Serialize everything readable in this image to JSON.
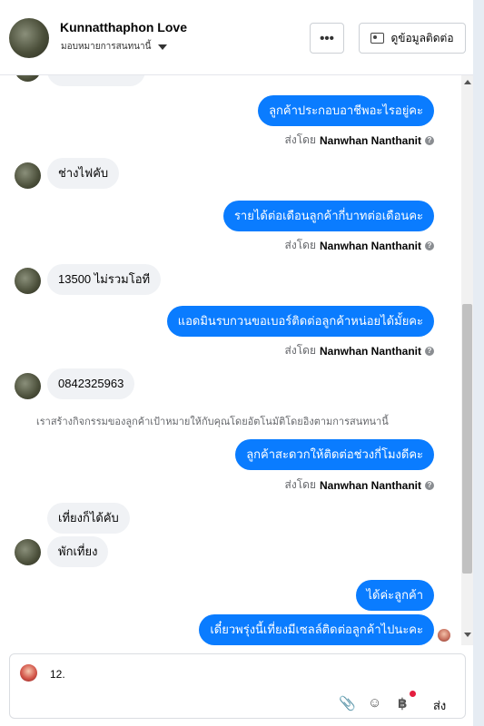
{
  "header": {
    "name": "Kunnatthaphon Love",
    "assign": "มอบหมายการสนทนานี้",
    "more_label": "•••",
    "contact_label": "ดูข้อมูลติดต่อ"
  },
  "messages": {
    "out1": "ลูกค้าประกอบอาชีพอะไรอยู่คะ",
    "in1": "ช่างไฟคับ",
    "out2": "รายได้ต่อเดือนลูกค้ากี่บาทต่อเดือนคะ",
    "in2": "13500 ไม่รวมโอที",
    "out3": "แอดมินรบกวนขอเบอร์ติดต่อลูกค้าหน่อยได้มั้ยคะ",
    "in3": "0842325963",
    "system_note": "เราสร้างกิจกรรมของลูกค้าเป้าหมายให้กับคุณโดยอัตโนมัติโดยอิงตามการสนทนานี้",
    "out4": "ลูกค้าสะดวกให้ติดต่อช่วงกี่โมงดีคะ",
    "in4": "เที่ยงก็ได้คับ",
    "in5": "พักเที่ยง",
    "out5": "ได้ค่ะลูกค้า",
    "out6": "เดี๋ยวพรุ่งนี้เที่ยงมีเซลล์ติดต่อลูกค้าไปนะคะ"
  },
  "sent_by": {
    "prefix": "ส่งโดย",
    "agent": "Nanwhan Nanthanit"
  },
  "composer": {
    "text": "12.",
    "send_label": "ส่ง"
  }
}
